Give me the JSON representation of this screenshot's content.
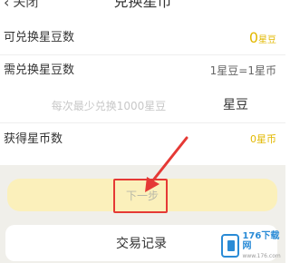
{
  "nav": {
    "back_label": "关闭",
    "title": "兑换星币"
  },
  "rows": {
    "available": {
      "label": "可兑换星豆数",
      "value": "0",
      "unit": "星豆"
    },
    "needed": {
      "label": "需兑换星豆数",
      "rate": "1星豆=1星币"
    },
    "input": {
      "placeholder": "每次最少兑换1000星豆",
      "unit": "星豆"
    },
    "obtain": {
      "label": "获得星币数",
      "value": "0星币"
    }
  },
  "buttons": {
    "next_label": "下一步",
    "records_label": "交易记录"
  },
  "watermark": {
    "main": "176下载网",
    "sub": "www.176.com"
  },
  "colors": {
    "gold": "#e2b800",
    "button_bg": "#fbf0bb",
    "footer_bg": "#f0efea",
    "highlight": "#e53935"
  }
}
